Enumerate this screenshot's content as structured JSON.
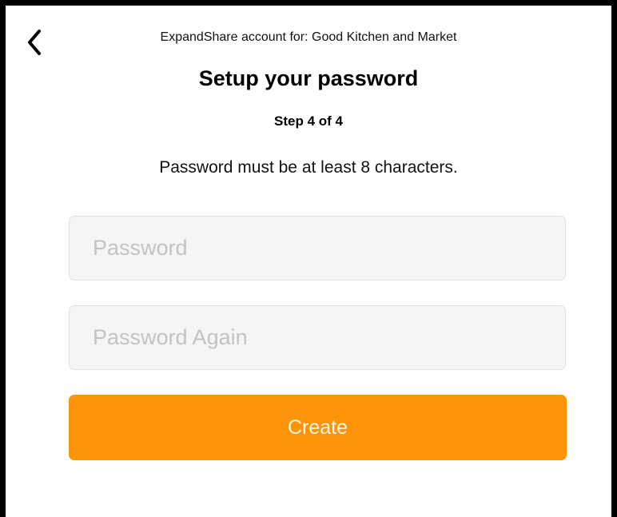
{
  "header": {
    "back_icon": "chevron-left-icon",
    "account_line": "ExpandShare account for: Good Kitchen and Market",
    "title": "Setup your password",
    "step": "Step 4 of 4"
  },
  "instructions": {
    "requirement": "Password must be at least 8 characters."
  },
  "form": {
    "password_placeholder": "Password",
    "password_value": "",
    "password_again_placeholder": "Password Again",
    "password_again_value": "",
    "create_label": "Create"
  },
  "colors": {
    "accent": "#fb9406",
    "field_background": "#f5f5f6",
    "placeholder": "#c3c3c7",
    "frame_border": "#000000"
  }
}
